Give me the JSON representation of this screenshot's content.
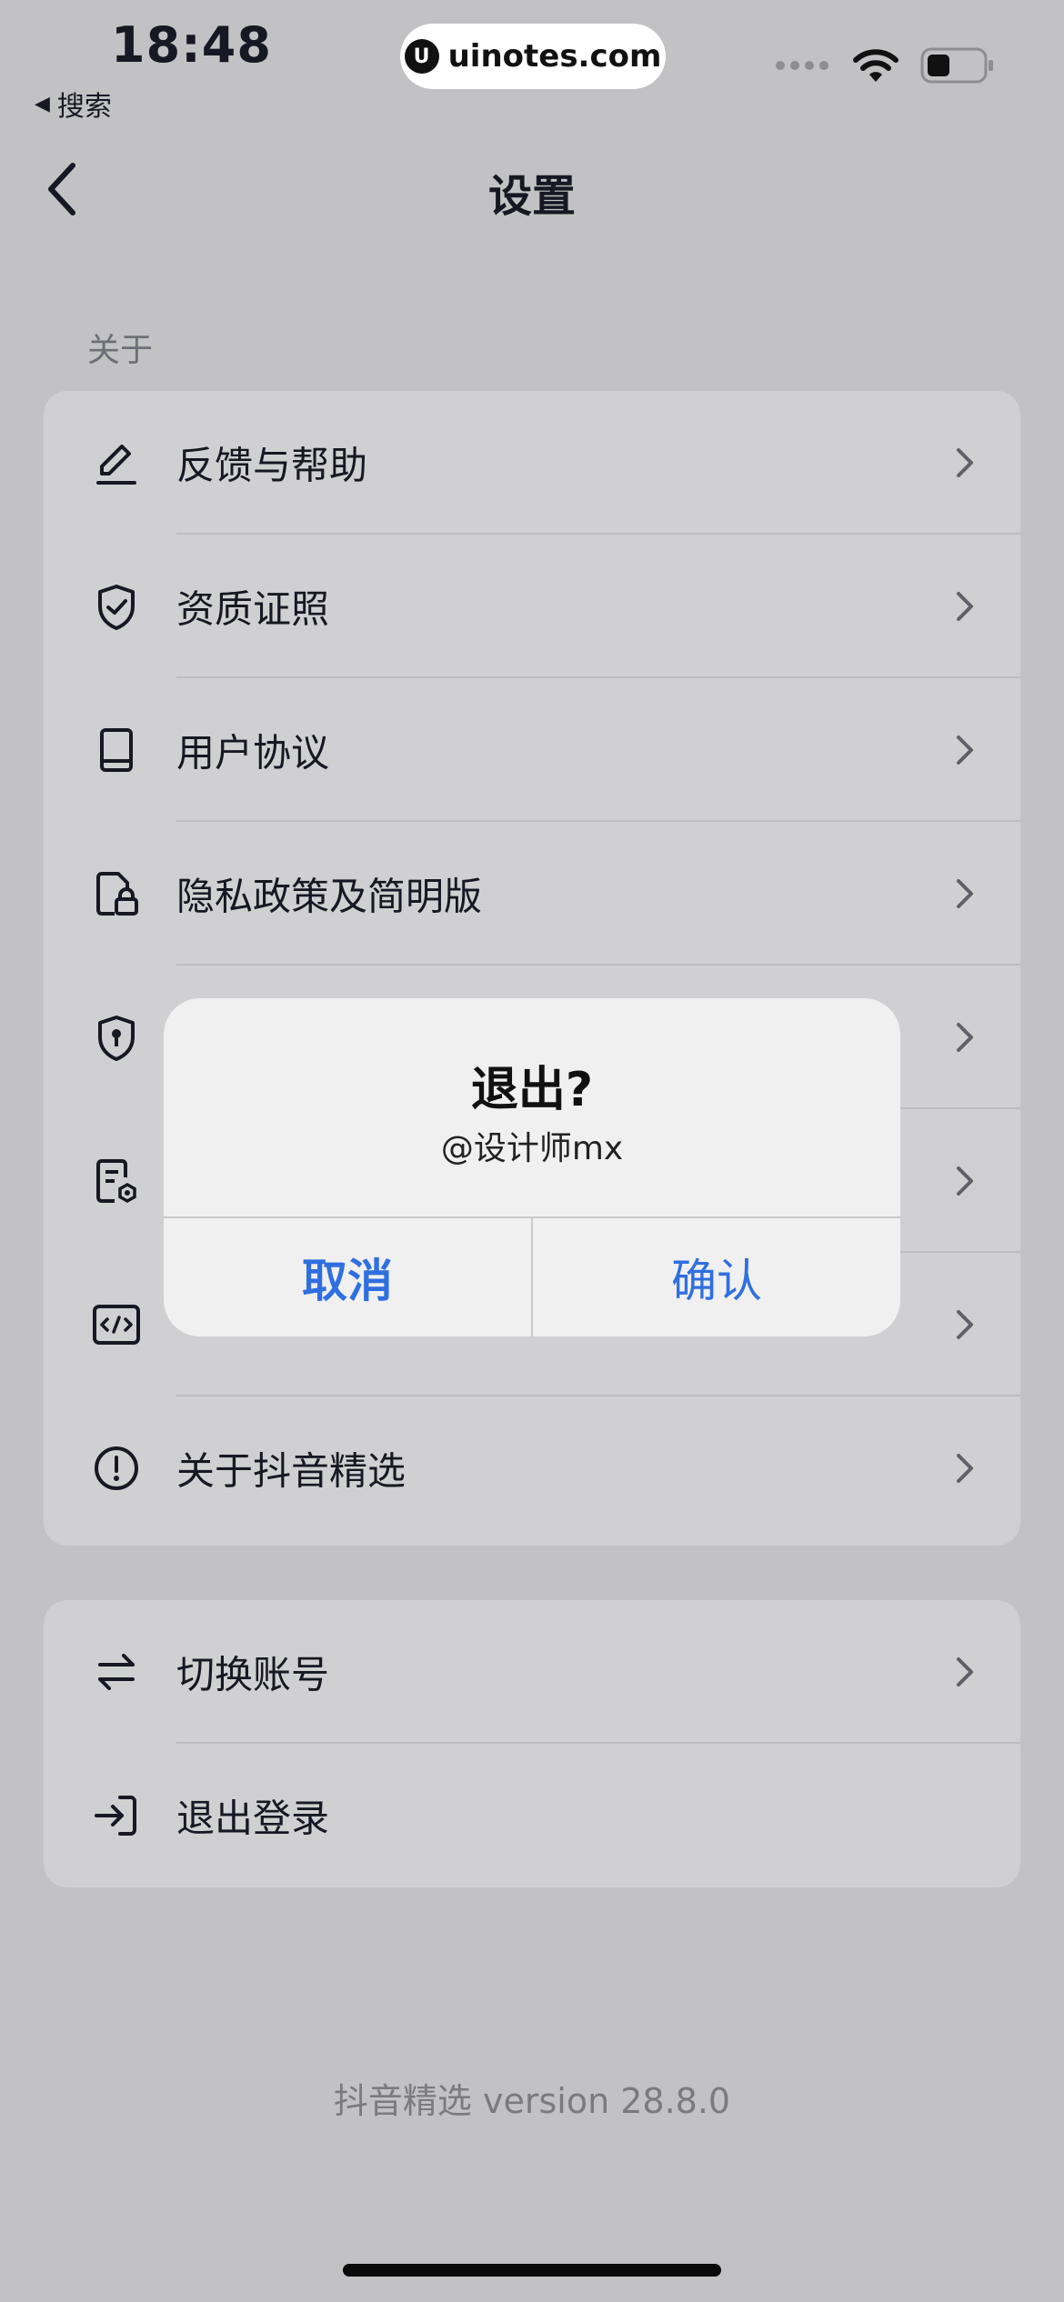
{
  "status_bar": {
    "time": "18:48",
    "back_app": "搜索",
    "url": "uinotes.com",
    "logo_glyph": "U"
  },
  "nav": {
    "title": "设置"
  },
  "section_about": {
    "label": "关于",
    "items": [
      {
        "label": "反馈与帮助",
        "icon": "pen-icon"
      },
      {
        "label": "资质证照",
        "icon": "shield-check-icon"
      },
      {
        "label": "用户协议",
        "icon": "book-icon"
      },
      {
        "label": "隐私政策及简明版",
        "icon": "doc-lock-icon"
      },
      {
        "label": "",
        "icon": "shield-key-icon"
      },
      {
        "label": "",
        "icon": "doc-gear-icon"
      },
      {
        "label": "",
        "icon": "code-icon"
      },
      {
        "label": "关于抖音精选",
        "icon": "info-circle-icon"
      }
    ]
  },
  "section_account": {
    "items": [
      {
        "label": "切换账号",
        "icon": "swap-icon",
        "chevron": true
      },
      {
        "label": "退出登录",
        "icon": "logout-icon",
        "chevron": false
      }
    ]
  },
  "version": "抖音精选 version 28.8.0",
  "alert": {
    "title": "退出?",
    "message": "@设计师mx",
    "cancel_label": "取消",
    "confirm_label": "确认"
  },
  "colors": {
    "background": "#c2c2c4",
    "card": "#d0d0d2",
    "alert_bg": "#f0f0f0",
    "accent_blue": "#2f6fe0"
  }
}
